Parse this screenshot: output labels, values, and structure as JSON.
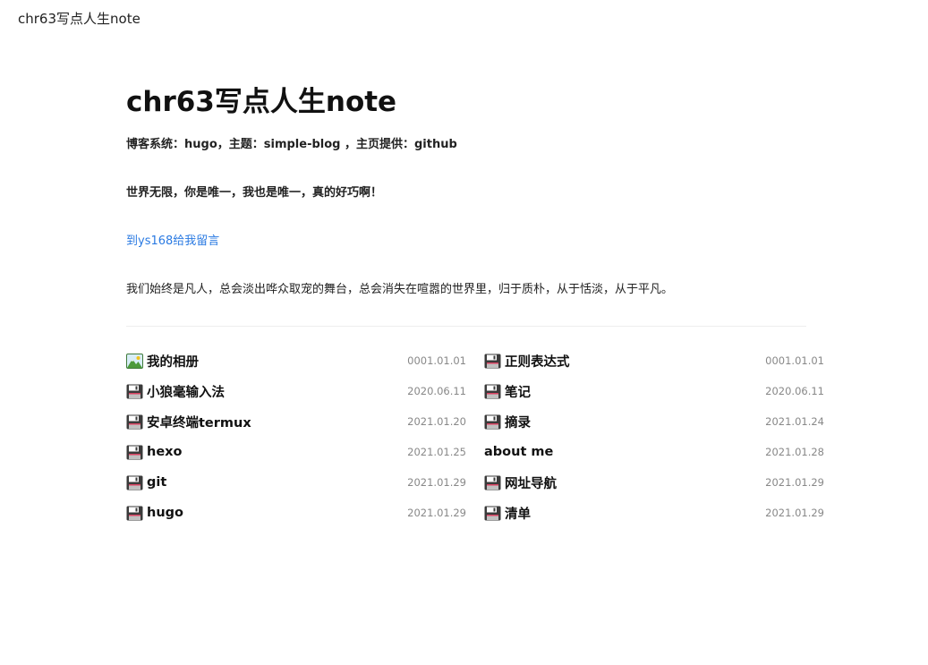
{
  "window_title": "chr63写点人生note",
  "header": {
    "site_title": "chr63写点人生note",
    "meta": "博客系统：hugo，主题：simple-blog ，主页提供：github",
    "motto": "世界无限，你是唯一，我也是唯一，真的好巧啊！",
    "guestbook_link": "到ys168给我留言",
    "quote": "我们始终是凡人，总会淡出哗众取宠的舞台，总会消失在喧嚣的世界里，归于质朴，从于恬淡，从于平凡。"
  },
  "posts": [
    {
      "title": "我的相册",
      "date": "0001.01.01",
      "icon": "photo-album-icon"
    },
    {
      "title": "正则表达式",
      "date": "0001.01.01",
      "icon": "floppy-disk-icon"
    },
    {
      "title": "小狼毫输入法",
      "date": "2020.06.11",
      "icon": "floppy-disk-icon"
    },
    {
      "title": "笔记",
      "date": "2020.06.11",
      "icon": "floppy-disk-icon"
    },
    {
      "title": "安卓终端termux",
      "date": "2021.01.20",
      "icon": "floppy-disk-icon"
    },
    {
      "title": "摘录",
      "date": "2021.01.24",
      "icon": "floppy-disk-icon"
    },
    {
      "title": "hexo",
      "date": "2021.01.25",
      "icon": "floppy-disk-icon"
    },
    {
      "title": "about me",
      "date": "2021.01.28",
      "icon": null
    },
    {
      "title": "git",
      "date": "2021.01.29",
      "icon": "floppy-disk-icon"
    },
    {
      "title": "网址导航",
      "date": "2021.01.29",
      "icon": "floppy-disk-icon"
    },
    {
      "title": "hugo",
      "date": "2021.01.29",
      "icon": "floppy-disk-icon"
    },
    {
      "title": "清单",
      "date": "2021.01.29",
      "icon": "floppy-disk-icon"
    }
  ],
  "colors": {
    "link": "#2a7ae2",
    "date": "#888888",
    "divider": "#eeeeee"
  }
}
